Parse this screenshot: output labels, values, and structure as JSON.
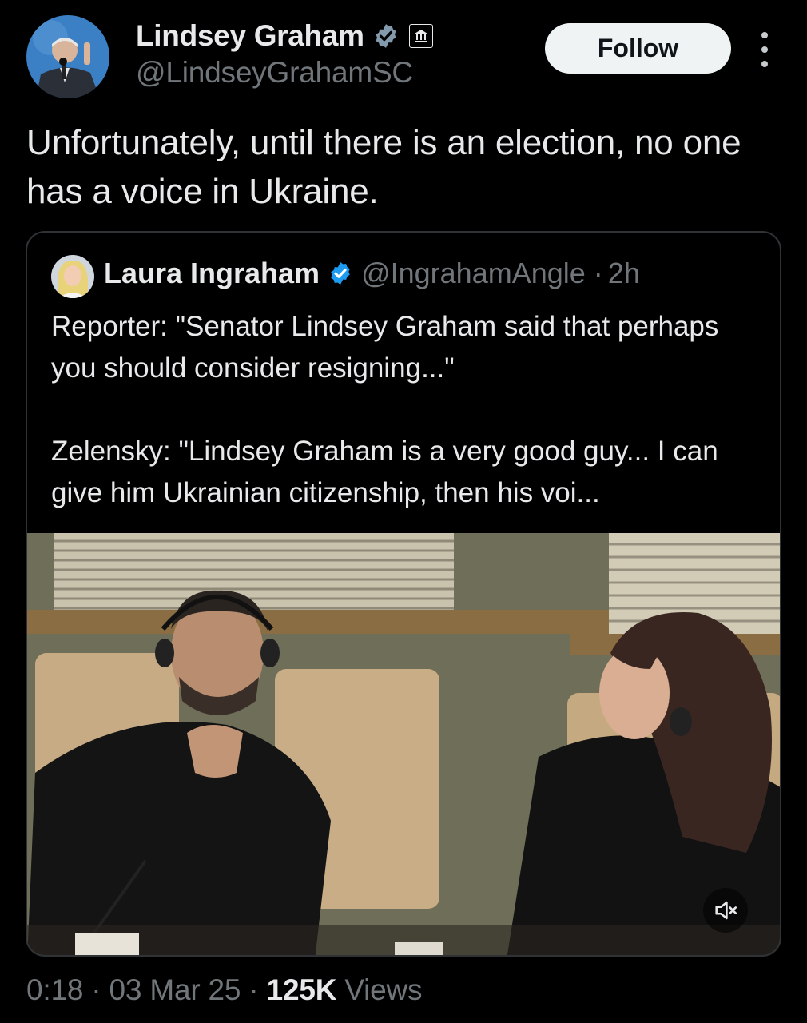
{
  "author": {
    "name": "Lindsey Graham",
    "handle": "@LindseyGrahamSC",
    "verified_icon": "verified-badge-icon",
    "affiliation_icon": "government-building-icon"
  },
  "follow_label": "Follow",
  "more_icon": "vertical-ellipsis-icon",
  "tweet_text": "Unfortunately, until there is an election, no one has a voice in Ukraine.",
  "quote": {
    "name": "Laura Ingraham",
    "handle": "@IngrahamAngle",
    "separator": "·",
    "time": "2h",
    "text": "Reporter: \"Senator Lindsey Graham said that perhaps you should consider resigning...\"\n\nZelensky: \"Lindsey Graham is a very good guy... I can give him Ukrainian citizenship, then his voi...",
    "video_mute_icon": "speaker-muted-icon"
  },
  "meta": {
    "timestamp": "0:18 · 03 Mar 25 · ",
    "views_count": "125K",
    "views_label": " Views"
  },
  "colors": {
    "background": "#000000",
    "text_primary": "#e7e9ea",
    "text_secondary": "#71767b",
    "verified_blue": "#1d9bf0",
    "verified_gray": "#829aab",
    "border": "#2f3336"
  }
}
